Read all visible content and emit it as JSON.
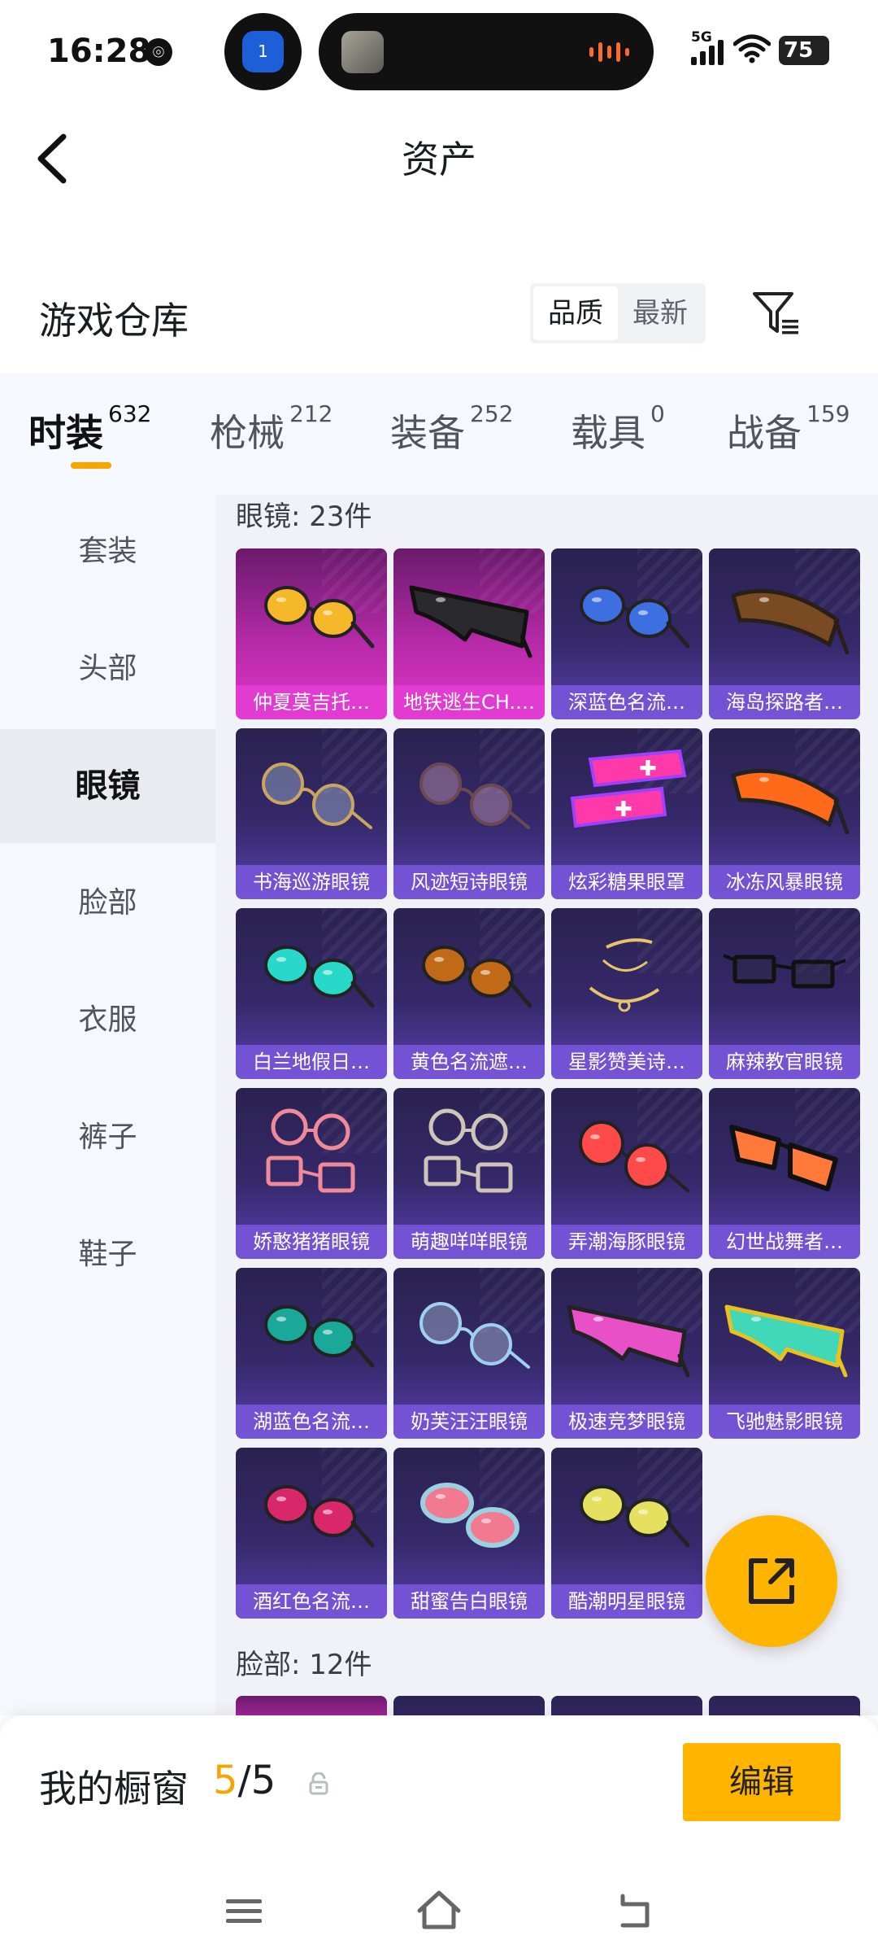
{
  "status_bar": {
    "time": "16:28",
    "notification_badge": "1",
    "network": "5G",
    "battery": "75"
  },
  "header": {
    "title": "资产",
    "warehouse_title": "游戏仓库",
    "sort_options": [
      "品质",
      "最新"
    ],
    "sort_selected": "品质"
  },
  "tabs": [
    {
      "label": "时装",
      "count": "632",
      "active": true
    },
    {
      "label": "枪械",
      "count": "212",
      "active": false
    },
    {
      "label": "装备",
      "count": "252",
      "active": false
    },
    {
      "label": "载具",
      "count": "0",
      "active": false
    },
    {
      "label": "战备",
      "count": "159",
      "active": false
    }
  ],
  "sidebar": [
    {
      "label": "套装"
    },
    {
      "label": "头部"
    },
    {
      "label": "眼镜",
      "active": true
    },
    {
      "label": "脸部"
    },
    {
      "label": "衣服"
    },
    {
      "label": "裤子"
    },
    {
      "label": "鞋子"
    }
  ],
  "sections": [
    {
      "title": "眼镜: 23件",
      "items": [
        {
          "name": "仲夏莫吉托…",
          "rarity": "pink",
          "icon": "aviator-sunglasses-icon",
          "tint": "#f5b82a",
          "frame": "#222"
        },
        {
          "name": "地铁逃生CH.…",
          "rarity": "pink",
          "icon": "shield-sunglasses-icon",
          "tint": "#2a2a2e",
          "frame": "#111"
        },
        {
          "name": "深蓝色名流…",
          "rarity": "purple",
          "icon": "aviator-sunglasses-icon",
          "tint": "#3d6fe0",
          "frame": "#222"
        },
        {
          "name": "海岛探路者…",
          "rarity": "purple",
          "icon": "sport-sunglasses-icon",
          "tint": "#7a4a22",
          "frame": "#2a1f18"
        },
        {
          "name": "书海巡游眼镜",
          "rarity": "purple",
          "icon": "round-glasses-icon",
          "tint": "#bfe0f0",
          "frame": "#c9a560"
        },
        {
          "name": "风迹短诗眼镜",
          "rarity": "purple",
          "icon": "round-glasses-icon",
          "tint": "#f0b8c8",
          "frame": "#6a4a50"
        },
        {
          "name": "炫彩糖果眼罩",
          "rarity": "purple",
          "icon": "visor-mask-icon",
          "tint": "#ff3aa8",
          "frame": "#a040ff"
        },
        {
          "name": "冰冻风暴眼镜",
          "rarity": "purple",
          "icon": "sport-sunglasses-icon",
          "tint": "#ff6a1a",
          "frame": "#222"
        },
        {
          "name": "白兰地假日…",
          "rarity": "purple",
          "icon": "aviator-sunglasses-icon",
          "tint": "#28d8c8",
          "frame": "#222"
        },
        {
          "name": "黄色名流遮…",
          "rarity": "purple",
          "icon": "aviator-sunglasses-icon",
          "tint": "#c06a18",
          "frame": "#222"
        },
        {
          "name": "星影赞美诗…",
          "rarity": "purple",
          "icon": "face-chain-icon",
          "tint": "#e7c46a",
          "frame": "#e7c46a"
        },
        {
          "name": "麻辣教官眼镜",
          "rarity": "purple",
          "icon": "square-glasses-icon",
          "tint": "#2a2a3a",
          "frame": "#111"
        },
        {
          "name": "娇憨猪猪眼镜",
          "rarity": "purple",
          "icon": "stacked-glasses-icon",
          "tint": "#f08a9a",
          "frame": "#f08a9a"
        },
        {
          "name": "萌趣咩咩眼镜",
          "rarity": "purple",
          "icon": "stacked-glasses-icon",
          "tint": "#cfc4b8",
          "frame": "#cfc4b8"
        },
        {
          "name": "弄潮海豚眼镜",
          "rarity": "purple",
          "icon": "round-sunglasses-icon",
          "tint": "#ff4a4a",
          "frame": "#222"
        },
        {
          "name": "幻世战舞者…",
          "rarity": "purple",
          "icon": "wayfarer-sunglasses-icon",
          "tint": "#ff7a3a",
          "frame": "#111"
        },
        {
          "name": "湖蓝色名流…",
          "rarity": "purple",
          "icon": "aviator-sunglasses-icon",
          "tint": "#1aa898",
          "frame": "#222"
        },
        {
          "name": "奶芙汪汪眼镜",
          "rarity": "purple",
          "icon": "round-glasses-icon",
          "tint": "#cfe6f6",
          "frame": "#9fd0f0"
        },
        {
          "name": "极速竞梦眼镜",
          "rarity": "purple",
          "icon": "shield-sunglasses-icon",
          "tint": "#e850c8",
          "frame": "#222"
        },
        {
          "name": "飞驰魅影眼镜",
          "rarity": "purple",
          "icon": "shield-sunglasses-icon",
          "tint": "#40d8b8",
          "frame": "#e8c020"
        },
        {
          "name": "酒红色名流…",
          "rarity": "purple",
          "icon": "aviator-sunglasses-icon",
          "tint": "#d8286a",
          "frame": "#222"
        },
        {
          "name": "甜蜜告白眼镜",
          "rarity": "purple",
          "icon": "oval-sunglasses-icon",
          "tint": "#f27a90",
          "frame": "#9ad0e0"
        },
        {
          "name": "酷潮明星眼镜",
          "rarity": "purple",
          "icon": "aviator-sunglasses-icon",
          "tint": "#e6e060",
          "frame": "#222"
        }
      ]
    },
    {
      "title": "脸部: 12件",
      "items": []
    }
  ],
  "showcase": {
    "title": "我的橱窗",
    "current": "5",
    "separator": "/",
    "total": "5",
    "edit_label": "编辑"
  },
  "colors": {
    "accent": "#ffb400",
    "tab_underline": "#f5a400",
    "card_purple": "#35296a",
    "card_pink": "#b62aa8"
  }
}
